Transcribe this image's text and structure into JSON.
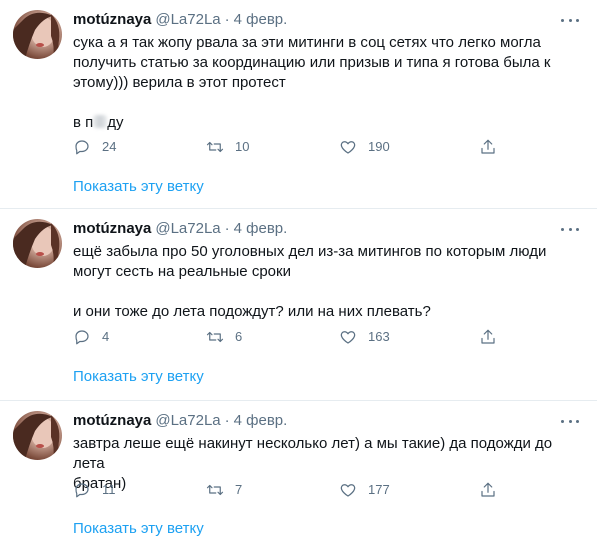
{
  "tweets": [
    {
      "name": "motúznaya",
      "handle": "@La72La",
      "separator": "·",
      "date": "4 февр.",
      "text_lines": [
        "сука а я так жопу рвала за эти митинги в соц сетях что легко могла",
        "получить статью за координацию или призыв и типа я готова была к",
        "этому))) верила в этот протест"
      ],
      "text2_prefix": "в п",
      "text2_suffix": "ду",
      "reply_count": "24",
      "retweet_count": "10",
      "like_count": "190",
      "thread_link": "Показать эту ветку"
    },
    {
      "name": "motúznaya",
      "handle": "@La72La",
      "separator": "·",
      "date": "4 февр.",
      "text_lines": [
        "ещё забыла про 50 уголовных дел из-за митингов по которым люди",
        "могут сесть на реальные сроки"
      ],
      "text2": "и они тоже до лета подождут? или на них плевать?",
      "reply_count": "4",
      "retweet_count": "6",
      "like_count": "163",
      "thread_link": "Показать эту ветку"
    },
    {
      "name": "motúznaya",
      "handle": "@La72La",
      "separator": "·",
      "date": "4 февр.",
      "text_lines": [
        "завтра леше ещё накинут несколько лет) а мы такие) да подожди до лета",
        "братан)"
      ],
      "reply_count": "11",
      "retweet_count": "7",
      "like_count": "177",
      "thread_link": "Показать эту ветку"
    }
  ],
  "icons": {
    "reply": "reply-icon",
    "retweet": "retweet-icon",
    "like": "heart-icon",
    "share": "share-icon",
    "more": "more-dots-icon"
  },
  "colors": {
    "text": "#0f1419",
    "secondary": "#5b7083",
    "link": "#1da1f2",
    "divider": "#e6ecf0"
  }
}
